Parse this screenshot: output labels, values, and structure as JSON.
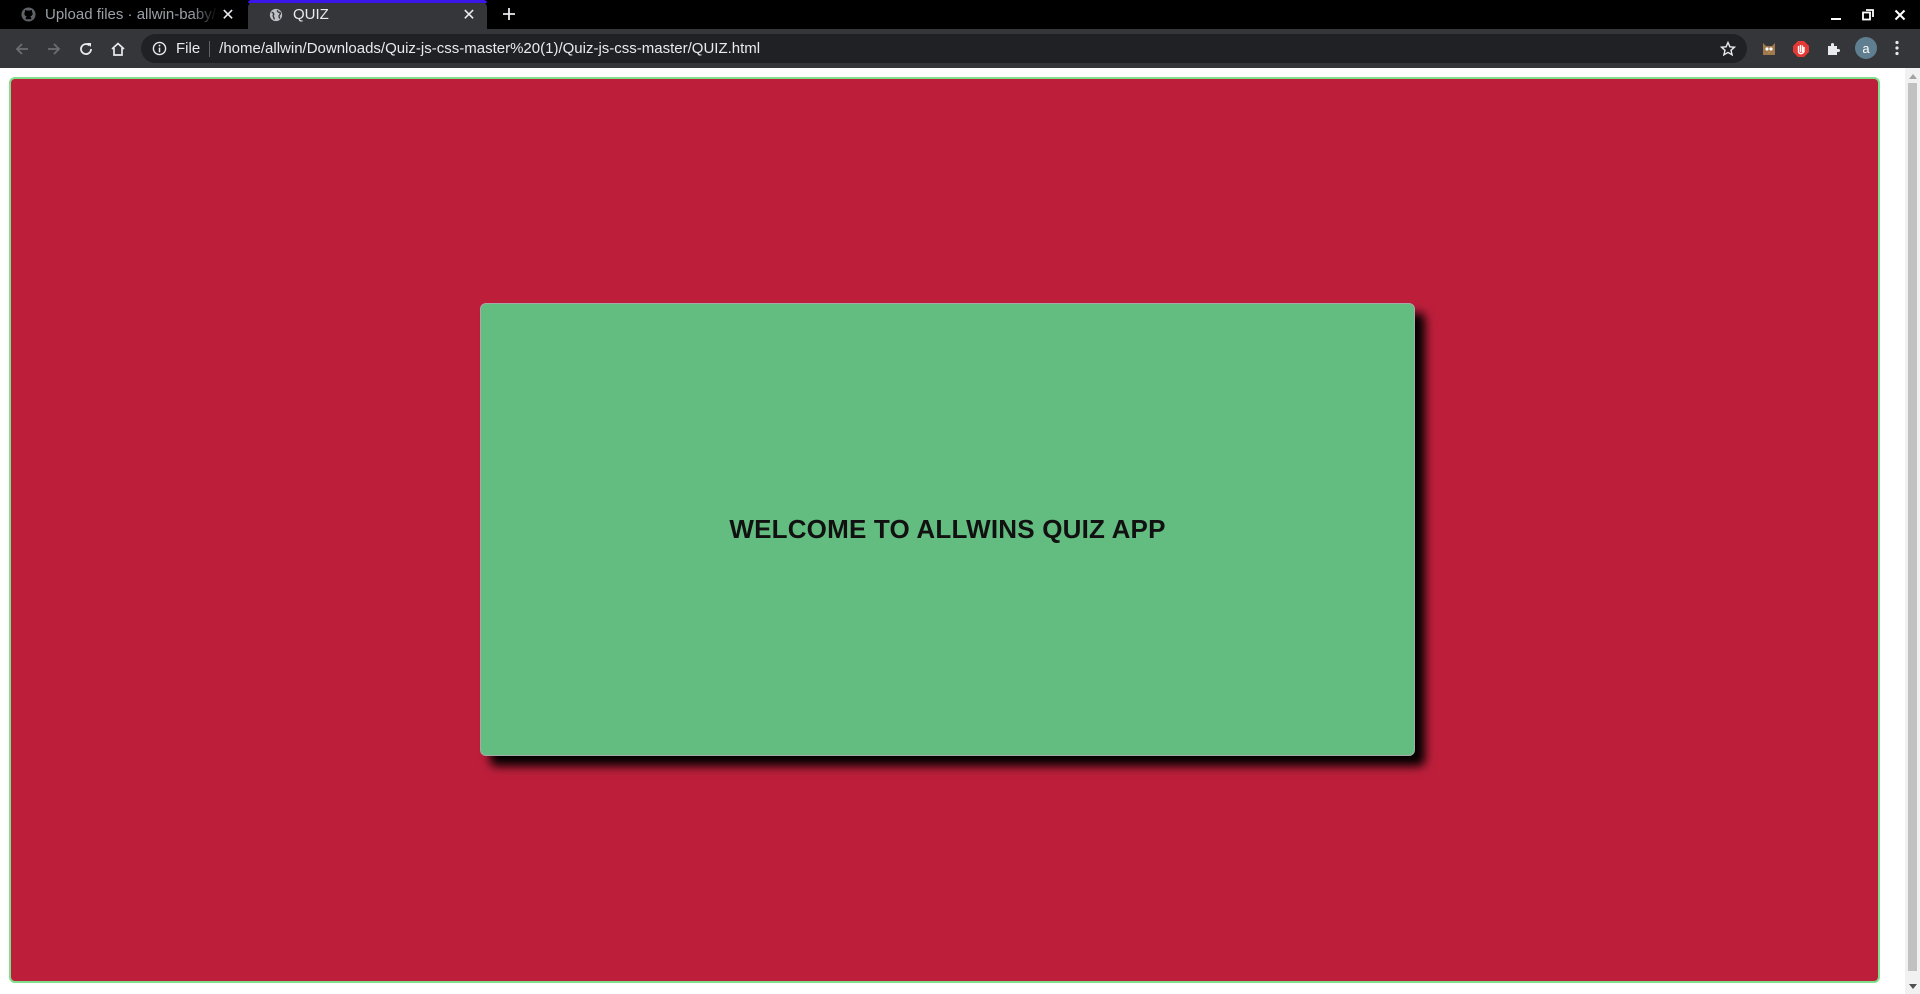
{
  "browser": {
    "tabs": [
      {
        "title": "Upload files · allwin-baby/",
        "favicon": "github-icon",
        "active": false
      },
      {
        "title": "QUIZ",
        "favicon": "globe-icon",
        "active": true
      }
    ],
    "new_tab_icon": "plus-icon",
    "address_bar": {
      "scheme_label": "File",
      "url": "/home/allwin/Downloads/Quiz-js-css-master%20(1)/Quiz-js-css-master/QUIZ.html"
    },
    "profile_initial": "a",
    "colors": {
      "tab_loading_bar": "#3b16e8",
      "toolbar": "#35363a"
    }
  },
  "page": {
    "background_color": "#bd1f3b",
    "border_color": "#7ee08a",
    "card": {
      "background_color": "#63bd80",
      "heading": "WELCOME TO ALLWINS QUIZ APP"
    }
  }
}
